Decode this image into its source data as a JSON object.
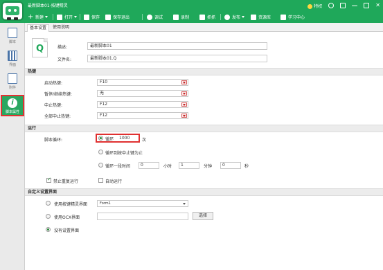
{
  "window": {
    "title": "最新脚本01-按键精灵",
    "vip_label": "特权"
  },
  "toolbar": {
    "new": "新建",
    "open": "打开",
    "save": "保存",
    "save_exit": "保存退出",
    "debug": "调试",
    "record": "录制",
    "capture": "抓抓",
    "publish": "发布",
    "resources": "资源库",
    "learn": "学习中心"
  },
  "sidebar": {
    "items": [
      {
        "label": "脚本",
        "icon": "script-icon"
      },
      {
        "label": "界面",
        "icon": "interface-icon"
      },
      {
        "label": "附件",
        "icon": "attachment-icon"
      },
      {
        "label": "脚本属性",
        "icon": "info-icon"
      }
    ]
  },
  "tabs": [
    "基本设置",
    "使用说明"
  ],
  "basic": {
    "desc_label": "描述:",
    "desc_value": "最新脚本01",
    "filename_label": "文件名:",
    "filename_value": "最新脚本01.Q",
    "file_icon_letter": "Q"
  },
  "hotkeys": {
    "section": "热键",
    "rows": [
      {
        "label": "启动热键:",
        "value": "F10"
      },
      {
        "label": "暂停/继续热键:",
        "value": "无"
      },
      {
        "label": "中止热键:",
        "value": "F12"
      },
      {
        "label": "全部中止热键:",
        "value": "F12"
      }
    ]
  },
  "run": {
    "section": "运行",
    "loop_label": "脚本循环:",
    "loop_option_label": "循环",
    "loop_count": "1000",
    "loop_unit": "次",
    "until_stop_label": "循环到按中止键为止",
    "timed_label": "循环一段时间",
    "hours_value": "0",
    "hours_unit": "小时",
    "minutes_value": "1",
    "minutes_unit": "分钟",
    "seconds_value": "0",
    "seconds_unit": "秒",
    "no_repeat_label": "禁止重复运行",
    "auto_run_label": "自动运行"
  },
  "custom_ui": {
    "section": "自定义设置界面",
    "use_anjian_label": "使用按键精灵界面",
    "form_value": "Form1",
    "use_ocx_label": "使用OCX界面",
    "select_button": "选择",
    "none_label": "没有设置界面"
  }
}
